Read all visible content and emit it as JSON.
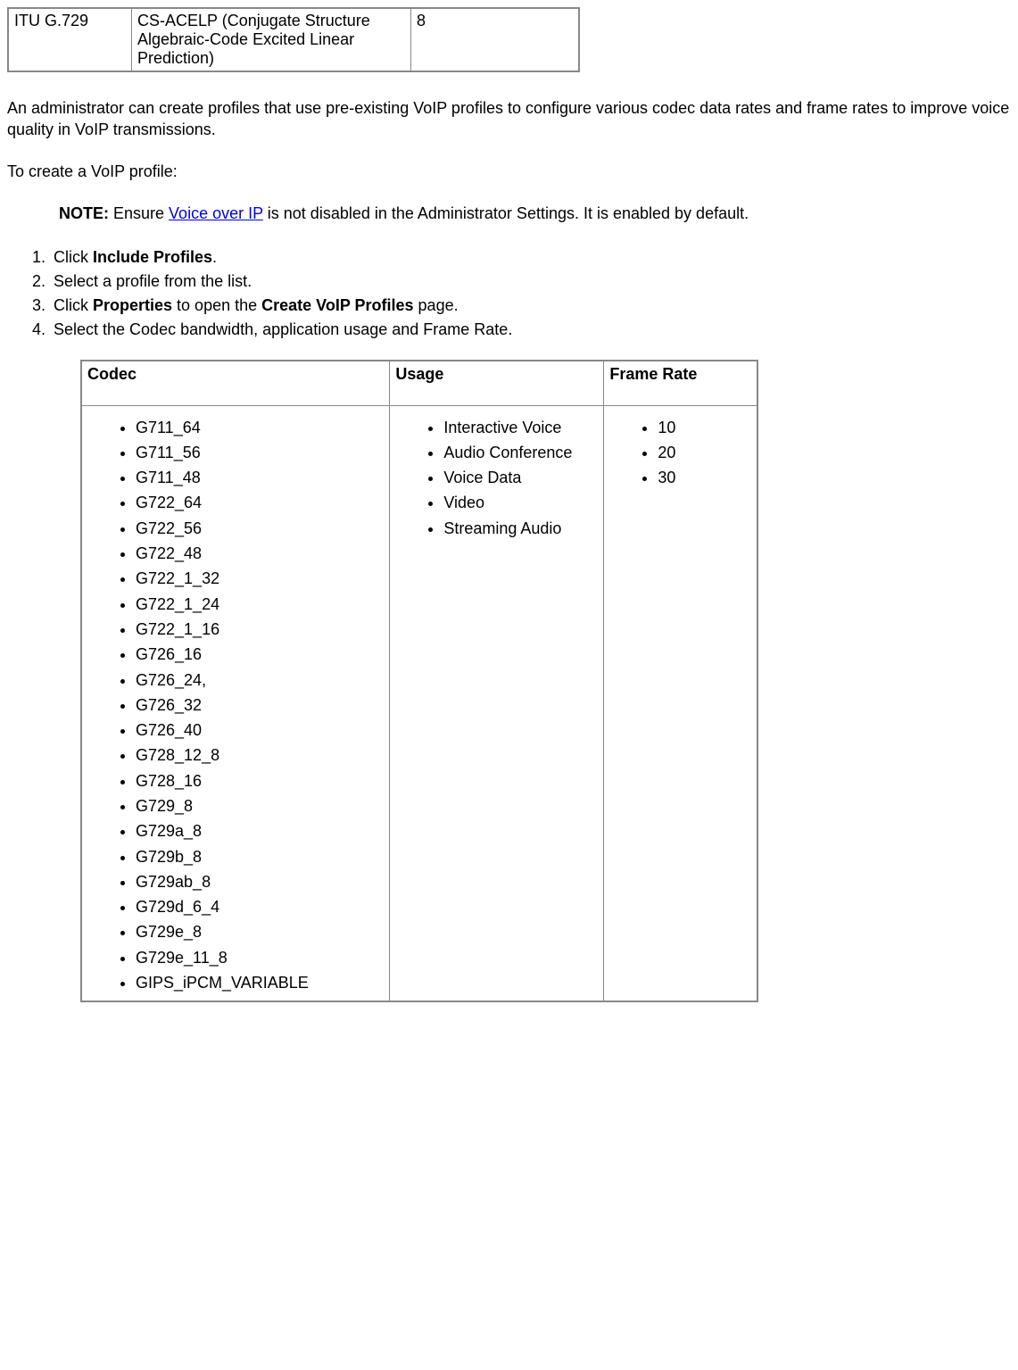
{
  "top_table": {
    "col1": "ITU G.729",
    "col2": "CS-ACELP (Conjugate Structure Algebraic-Code Excited Linear Prediction)",
    "col3": "8"
  },
  "intro_paragraph": "An administrator can create profiles that use pre-existing VoIP profiles to configure various codec data rates and frame rates to improve voice quality in VoIP transmissions.",
  "create_heading": "To create a VoIP profile:",
  "note": {
    "label": "NOTE:",
    "before_link": " Ensure ",
    "link_text": "Voice over IP",
    "after_link": " is not disabled in the Administrator Settings. It is enabled by default."
  },
  "steps": {
    "s1_pre": "Click ",
    "s1_bold": "Include Profiles",
    "s1_post": ".",
    "s2": "Select a profile from the list.",
    "s3_pre": "Click ",
    "s3_bold1": "Properties",
    "s3_mid": " to open the ",
    "s3_bold2": "Create VoIP Profiles",
    "s3_post": " page.",
    "s4": "Select the Codec bandwidth, application usage and Frame Rate."
  },
  "codec_table": {
    "headers": {
      "codec": "Codec",
      "usage": "Usage",
      "frame": "Frame Rate"
    },
    "codec_items": [
      "G711_64",
      "G711_56",
      "G711_48",
      "G722_64",
      "G722_56",
      "G722_48",
      "G722_1_32",
      "G722_1_24",
      "G722_1_16",
      "G726_16",
      "G726_24,",
      "G726_32",
      "G726_40",
      "G728_12_8",
      "G728_16",
      "G729_8",
      "G729a_8",
      "G729b_8",
      "G729ab_8",
      "G729d_6_4",
      "G729e_8",
      "G729e_11_8",
      "GIPS_iPCM_VARIABLE"
    ],
    "usage_items": [
      "Interactive Voice",
      "Audio Conference",
      "Voice Data",
      "Video",
      "Streaming Audio"
    ],
    "frame_items": [
      "10",
      "20",
      "30"
    ]
  }
}
